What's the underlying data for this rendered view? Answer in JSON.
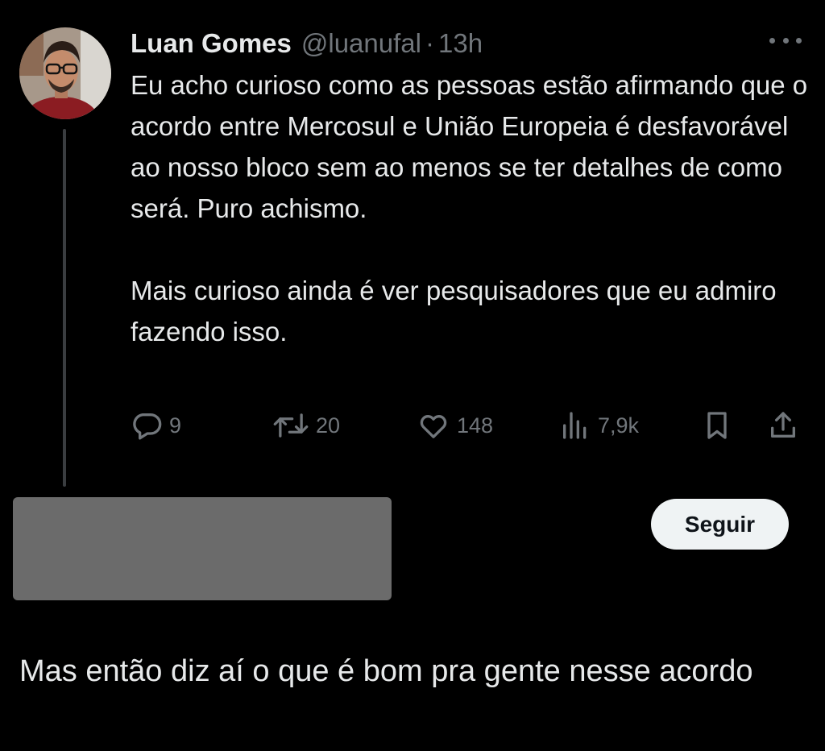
{
  "tweet": {
    "author_name": "Luan Gomes",
    "author_handle": "@luanufal",
    "separator": "·",
    "time": "13h",
    "paragraph_1": "Eu acho curioso como as pessoas estão afirmando que o acordo entre Mercosul e União Europeia é desfavorável ao nosso bloco sem ao menos se ter detalhes de como será. Puro achismo.",
    "paragraph_2": "Mais curioso ainda é ver pesquisadores que eu admiro fazendo isso.",
    "actions": {
      "replies": "9",
      "reposts": "20",
      "likes": "148",
      "views": "7,9k"
    },
    "icons": {
      "reply": "reply-icon",
      "repost": "repost-icon",
      "like": "heart-icon",
      "views": "views-icon",
      "bookmark": "bookmark-icon",
      "share": "share-icon",
      "more": "more-icon"
    }
  },
  "reply": {
    "follow_label": "Seguir",
    "text": "Mas então diz aí o que é bom pra gente nesse acordo"
  },
  "colors": {
    "background": "#000000",
    "text": "#e7e9ea",
    "secondary": "#71767b",
    "redaction": "#6b6b6b",
    "follow_bg": "#eff3f4"
  }
}
